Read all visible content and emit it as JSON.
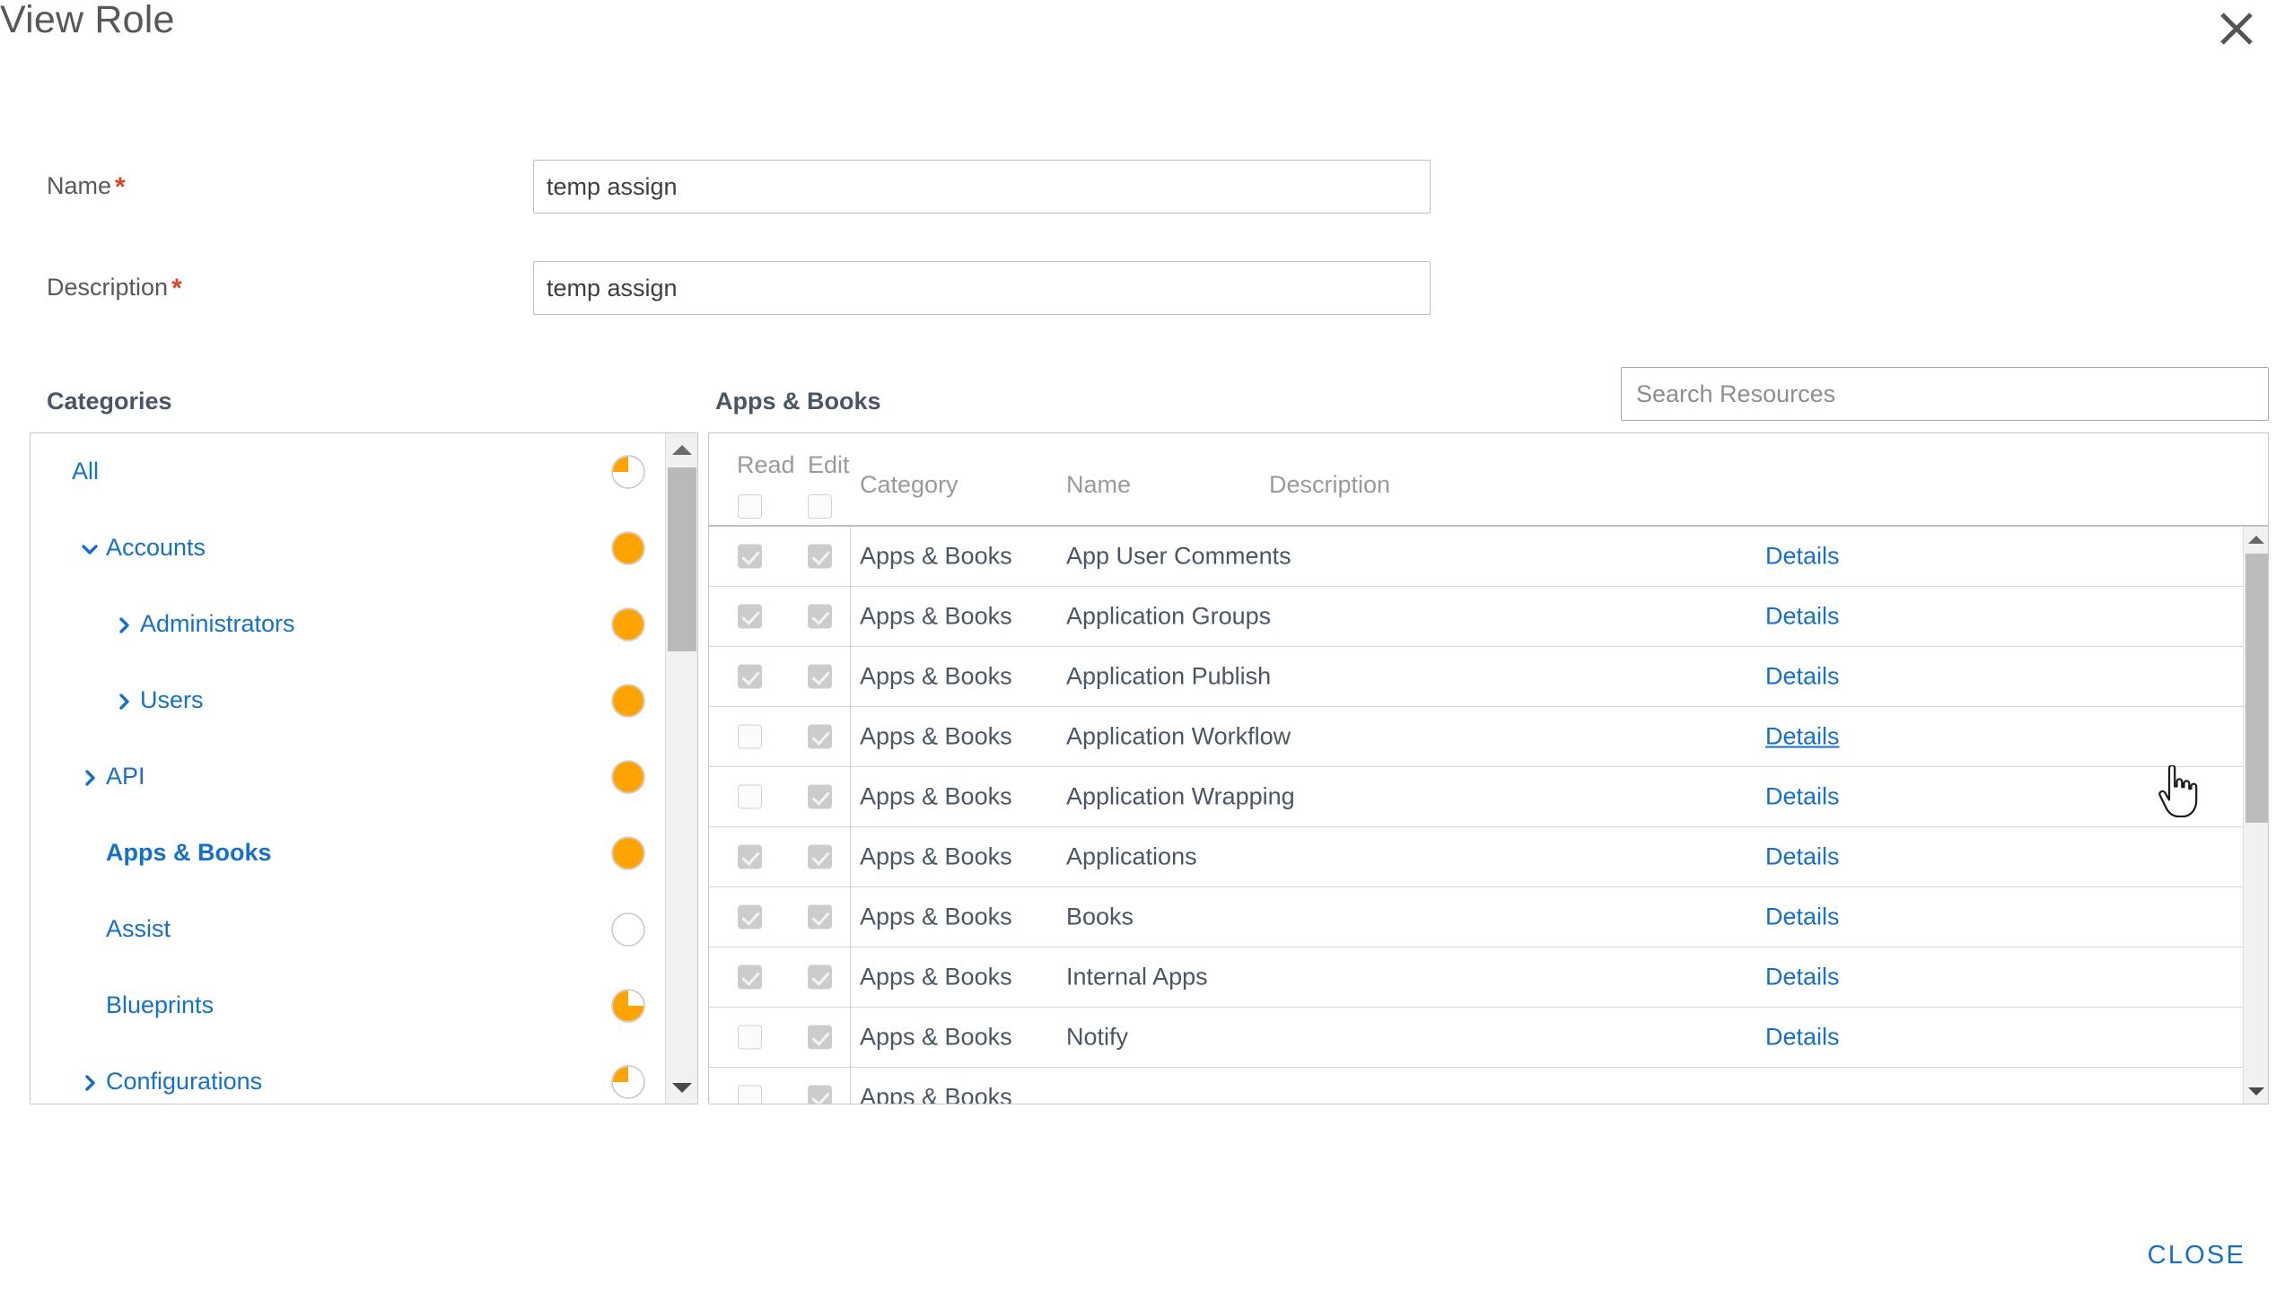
{
  "dialog": {
    "title": "View Role",
    "close_icon": "close-icon",
    "footer_close_label": "CLOSE"
  },
  "form": {
    "name": {
      "label": "Name",
      "required_marker": "*",
      "value": "temp assign"
    },
    "description": {
      "label": "Description",
      "required_marker": "*",
      "value": "temp assign"
    }
  },
  "categories": {
    "heading": "Categories",
    "items": [
      {
        "label": "All",
        "indent": 0,
        "caret": "none",
        "pie": 25,
        "bold": false
      },
      {
        "label": "Accounts",
        "indent": 1,
        "caret": "down",
        "pie": 100,
        "bold": false
      },
      {
        "label": "Administrators",
        "indent": 2,
        "caret": "right",
        "pie": 100,
        "bold": false
      },
      {
        "label": "Users",
        "indent": 2,
        "caret": "right",
        "pie": 100,
        "bold": false
      },
      {
        "label": "API",
        "indent": 1,
        "caret": "right",
        "pie": 100,
        "bold": false
      },
      {
        "label": "Apps & Books",
        "indent": 1,
        "caret": "none",
        "pie": 100,
        "bold": true
      },
      {
        "label": "Assist",
        "indent": 1,
        "caret": "none",
        "pie": 0,
        "bold": false
      },
      {
        "label": "Blueprints",
        "indent": 1,
        "caret": "none",
        "pie": 75,
        "bold": false
      },
      {
        "label": "Configurations",
        "indent": 1,
        "caret": "right",
        "pie": 25,
        "bold": false
      }
    ]
  },
  "resources": {
    "heading": "Apps & Books",
    "search": {
      "placeholder": "Search Resources",
      "value": ""
    },
    "columns": {
      "read": "Read",
      "edit": "Edit",
      "category": "Category",
      "name": "Name",
      "description": "Description"
    },
    "header_checkboxes": {
      "read": false,
      "edit": false
    },
    "details_label": "Details",
    "rows": [
      {
        "read": true,
        "edit": true,
        "category": "Apps & Books",
        "name": "App User Comments",
        "description": "",
        "details": "Details",
        "hover": false
      },
      {
        "read": true,
        "edit": true,
        "category": "Apps & Books",
        "name": "Application Groups",
        "description": "",
        "details": "Details",
        "hover": false
      },
      {
        "read": true,
        "edit": true,
        "category": "Apps & Books",
        "name": "Application Publish",
        "description": "",
        "details": "Details",
        "hover": false
      },
      {
        "read": false,
        "edit": true,
        "category": "Apps & Books",
        "name": "Application Workflow",
        "description": "",
        "details": "Details",
        "hover": true
      },
      {
        "read": false,
        "edit": true,
        "category": "Apps & Books",
        "name": "Application Wrapping",
        "description": "",
        "details": "Details",
        "hover": false
      },
      {
        "read": true,
        "edit": true,
        "category": "Apps & Books",
        "name": "Applications",
        "description": "",
        "details": "Details",
        "hover": false
      },
      {
        "read": true,
        "edit": true,
        "category": "Apps & Books",
        "name": "Books",
        "description": "",
        "details": "Details",
        "hover": false
      },
      {
        "read": true,
        "edit": true,
        "category": "Apps & Books",
        "name": "Internal Apps",
        "description": "",
        "details": "Details",
        "hover": false
      },
      {
        "read": false,
        "edit": true,
        "category": "Apps & Books",
        "name": "Notify",
        "description": "",
        "details": "Details",
        "hover": false
      },
      {
        "read": false,
        "edit": true,
        "category": "Apps & Books",
        "name": "",
        "description": "",
        "details": "",
        "hover": false
      }
    ]
  },
  "colors": {
    "link": "#1670c8",
    "accent_orange": "#FFA300",
    "required": "#d9442a",
    "text": "#4a5663",
    "muted": "#9a9a9a"
  }
}
